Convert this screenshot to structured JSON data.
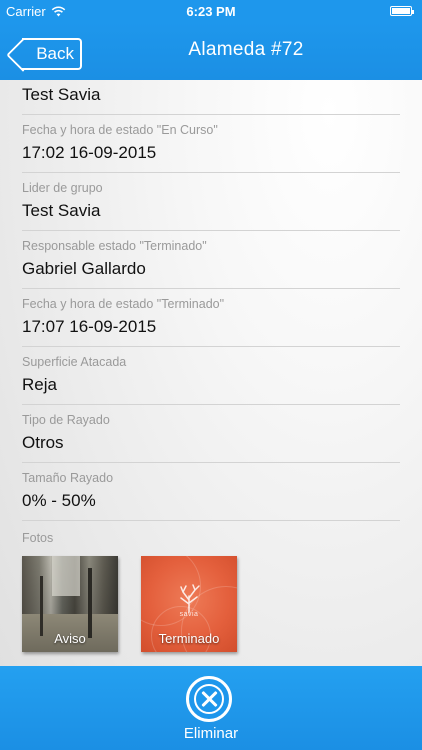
{
  "status_bar": {
    "carrier": "Carrier",
    "time": "6:23 PM"
  },
  "nav": {
    "back_label": "Back",
    "title": "Alameda #72"
  },
  "detail": {
    "first_value": "Test Savia",
    "fields": [
      {
        "label": "Fecha y hora de estado \"En Curso\"",
        "value": "17:02 16-09-2015"
      },
      {
        "label": "Lider de grupo",
        "value": "Test Savia"
      },
      {
        "label": "Responsable estado \"Terminado\"",
        "value": "Gabriel Gallardo"
      },
      {
        "label": "Fecha y hora de estado \"Terminado\"",
        "value": "17:07 16-09-2015"
      },
      {
        "label": "Superficie Atacada",
        "value": "Reja"
      },
      {
        "label": "Tipo de Rayado",
        "value": "Otros"
      },
      {
        "label": "Tamaño Rayado",
        "value": "0% - 50%"
      }
    ],
    "photos_label": "Fotos",
    "photos": [
      {
        "caption": "Aviso"
      },
      {
        "caption": "Terminado",
        "logo_text": "savia"
      }
    ]
  },
  "toolbar": {
    "delete_label": "Eliminar"
  },
  "colors": {
    "accent": "#1e97ec",
    "label_gray": "#9a9a9a",
    "divider": "#d3d3d3"
  }
}
